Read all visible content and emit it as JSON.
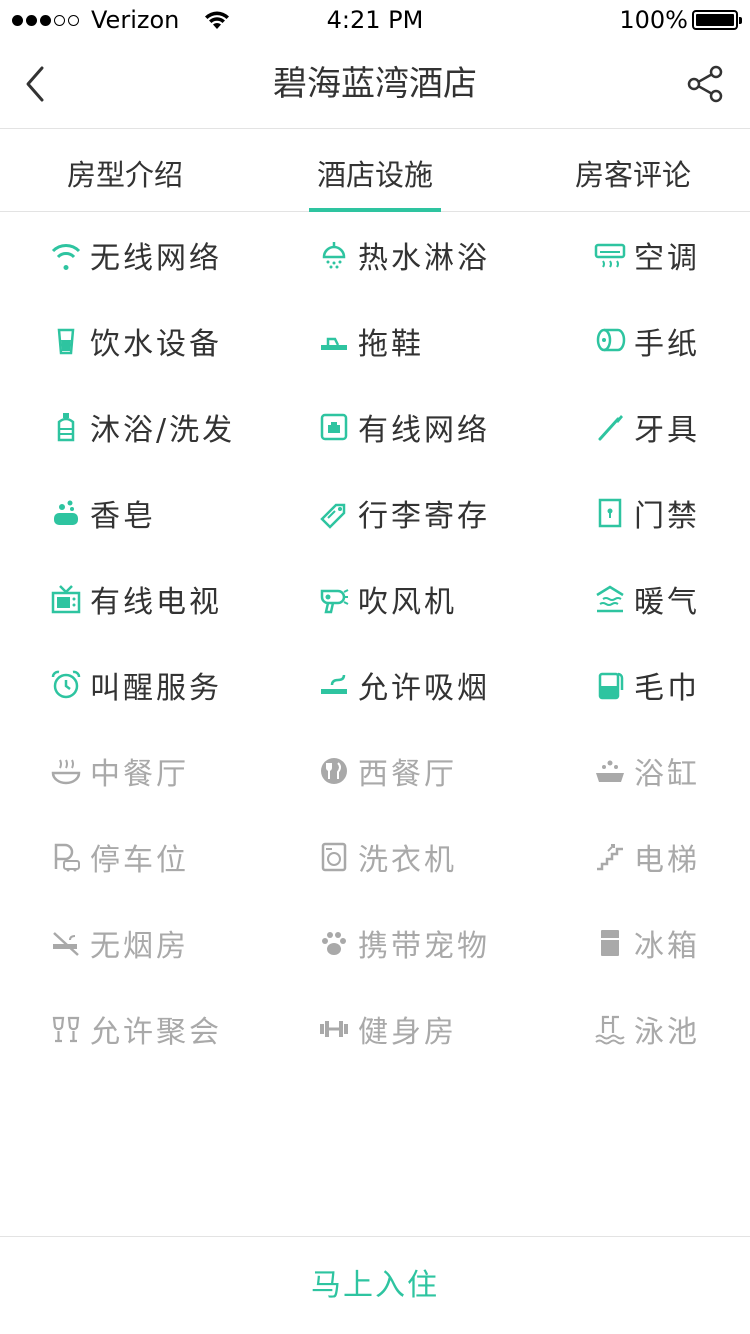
{
  "status_bar": {
    "carrier": "Verizon",
    "time": "4:21 PM",
    "battery": "100%"
  },
  "nav": {
    "title": "碧海蓝湾酒店"
  },
  "tabs": [
    {
      "label": "房型介绍"
    },
    {
      "label": "酒店设施"
    },
    {
      "label": "房客评论"
    }
  ],
  "active_tab": "酒店设施",
  "colors": {
    "accent": "#2ec4a0",
    "available_text": "#333333",
    "unavailable": "#a9a9a9"
  },
  "facilities": [
    [
      {
        "label": "无线网络",
        "icon": "wifi-icon",
        "available": true
      },
      {
        "label": "热水淋浴",
        "icon": "shower-icon",
        "available": true
      },
      {
        "label": "空调",
        "icon": "air-conditioner-icon",
        "available": true
      }
    ],
    [
      {
        "label": "饮水设备",
        "icon": "cup-icon",
        "available": true
      },
      {
        "label": "拖鞋",
        "icon": "slipper-icon",
        "available": true
      },
      {
        "label": "手纸",
        "icon": "toilet-paper-icon",
        "available": true
      }
    ],
    [
      {
        "label": "沐浴/洗发",
        "icon": "shampoo-bottle-icon",
        "available": true
      },
      {
        "label": "有线网络",
        "icon": "ethernet-icon",
        "available": true
      },
      {
        "label": "牙具",
        "icon": "toothbrush-icon",
        "available": true
      }
    ],
    [
      {
        "label": "香皂",
        "icon": "soap-icon",
        "available": true
      },
      {
        "label": "行李寄存",
        "icon": "luggage-tag-icon",
        "available": true
      },
      {
        "label": "门禁",
        "icon": "door-lock-icon",
        "available": true
      }
    ],
    [
      {
        "label": "有线电视",
        "icon": "tv-icon",
        "available": true
      },
      {
        "label": "吹风机",
        "icon": "hair-dryer-icon",
        "available": true
      },
      {
        "label": "暖气",
        "icon": "heating-icon",
        "available": true
      }
    ],
    [
      {
        "label": "叫醒服务",
        "icon": "alarm-clock-icon",
        "available": true
      },
      {
        "label": "允许吸烟",
        "icon": "smoking-icon",
        "available": true
      },
      {
        "label": "毛巾",
        "icon": "towel-icon",
        "available": true
      }
    ],
    [
      {
        "label": "中餐厅",
        "icon": "chinese-dish-icon",
        "available": false
      },
      {
        "label": "西餐厅",
        "icon": "western-dining-icon",
        "available": false
      },
      {
        "label": "浴缸",
        "icon": "bathtub-icon",
        "available": false
      }
    ],
    [
      {
        "label": "停车位",
        "icon": "parking-icon",
        "available": false
      },
      {
        "label": "洗衣机",
        "icon": "washing-machine-icon",
        "available": false
      },
      {
        "label": "电梯",
        "icon": "elevator-stairs-icon",
        "available": false
      }
    ],
    [
      {
        "label": "无烟房",
        "icon": "no-smoking-icon",
        "available": false
      },
      {
        "label": "携带宠物",
        "icon": "paw-icon",
        "available": false
      },
      {
        "label": "冰箱",
        "icon": "fridge-icon",
        "available": false
      }
    ],
    [
      {
        "label": "允许聚会",
        "icon": "cheers-icon",
        "available": false
      },
      {
        "label": "健身房",
        "icon": "dumbbell-icon",
        "available": false
      },
      {
        "label": "泳池",
        "icon": "swimming-pool-icon",
        "available": false
      }
    ]
  ],
  "bottom": {
    "checkin_label": "马上入住"
  }
}
